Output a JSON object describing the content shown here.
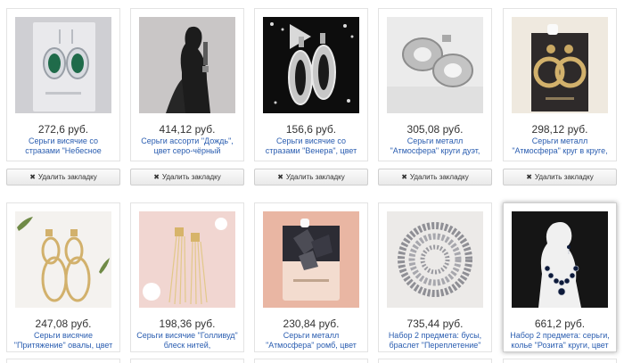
{
  "bookmarks": [
    {
      "price": "272,6 руб.",
      "title": "Серьги висячие со стразами \"Небесное",
      "remove_label": "Удалить закладку",
      "remove_icon": "close-icon"
    },
    {
      "price": "414,12 руб.",
      "title": "Серьги ассорти \"Дождь\", цвет серо-чёрный",
      "remove_label": "Удалить закладку",
      "remove_icon": "close-icon"
    },
    {
      "price": "156,6 руб.",
      "title": "Серьги висячие со стразами \"Венера\", цвет",
      "remove_label": "Удалить закладку",
      "remove_icon": "close-icon"
    },
    {
      "price": "305,08 руб.",
      "title": "Серьги металл \"Атмосфера\" круги дуэт,",
      "remove_label": "Удалить закладку",
      "remove_icon": "close-icon"
    },
    {
      "price": "298,12 руб.",
      "title": "Серьги металл \"Атмосфера\" круг в круге,",
      "remove_label": "Удалить закладку",
      "remove_icon": "close-icon"
    },
    {
      "price": "247,08 руб.",
      "title": "Серьги висячие \"Притяжение\" овалы, цвет"
    },
    {
      "price": "198,36 руб.",
      "title": "Серьги висячие \"Голливуд\" блеск нитей,"
    },
    {
      "price": "230,84 руб.",
      "title": "Серьги металл \"Атмосфера\" ромб, цвет"
    },
    {
      "price": "735,44 руб.",
      "title": "Набор 2 предмета: бусы, браслет \"Переплетение\""
    },
    {
      "price": "661,2 руб.",
      "title": "Набор 2 предмета: серьги, колье \"Розита\" круги, цвет"
    }
  ]
}
